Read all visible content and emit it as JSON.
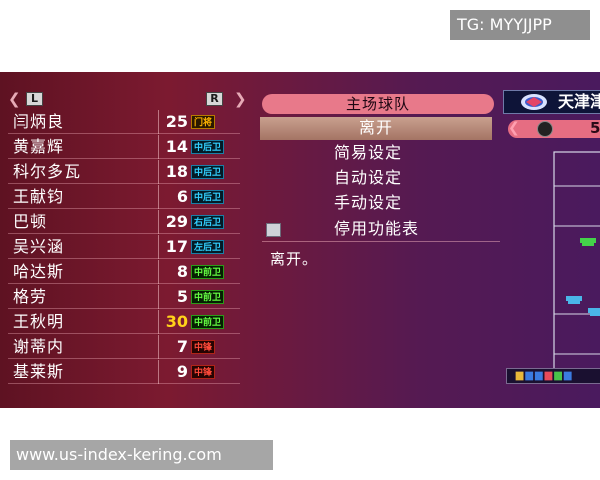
{
  "watermarks": {
    "top": "TG: MYYJJPP",
    "bottom": "www.us-index-kering.com"
  },
  "roster": {
    "left_key": "L",
    "right_key": "R",
    "players": [
      {
        "name": "闫炳良",
        "number": "25",
        "position": "门将",
        "role": "gk",
        "highlight": false
      },
      {
        "name": "黄嘉辉",
        "number": "14",
        "position": "中后卫",
        "role": "def",
        "highlight": false
      },
      {
        "name": "科尔多瓦",
        "number": "18",
        "position": "中后卫",
        "role": "def",
        "highlight": false
      },
      {
        "name": "王献钧",
        "number": "6",
        "position": "中后卫",
        "role": "def",
        "highlight": false
      },
      {
        "name": "巴顿",
        "number": "29",
        "position": "右后卫",
        "role": "def",
        "highlight": false
      },
      {
        "name": "吴兴涵",
        "number": "17",
        "position": "左后卫",
        "role": "def",
        "highlight": false
      },
      {
        "name": "哈达斯",
        "number": "8",
        "position": "中前卫",
        "role": "mid",
        "highlight": false
      },
      {
        "name": "格劳",
        "number": "5",
        "position": "中前卫",
        "role": "mid",
        "highlight": false
      },
      {
        "name": "王秋明",
        "number": "30",
        "position": "中前卫",
        "role": "mid",
        "highlight": true
      },
      {
        "name": "谢蒂内",
        "number": "7",
        "position": "中锋",
        "role": "fwd",
        "highlight": false
      },
      {
        "name": "基莱斯",
        "number": "9",
        "position": "中锋",
        "role": "fwd",
        "highlight": false
      }
    ]
  },
  "menu": {
    "title": "主场球队",
    "selected": "离开",
    "items": [
      "简易设定",
      "自动设定",
      "手动设定",
      "停用功能表"
    ],
    "description": "离开。"
  },
  "team": {
    "name": "天津津门虎",
    "formation_label": "5"
  },
  "colors": {
    "gk": "#ffb400",
    "def": "#33d0ff",
    "mid": "#66ff44",
    "fwd": "#ff4a3a",
    "menu_title_bg": "#e8798a"
  }
}
